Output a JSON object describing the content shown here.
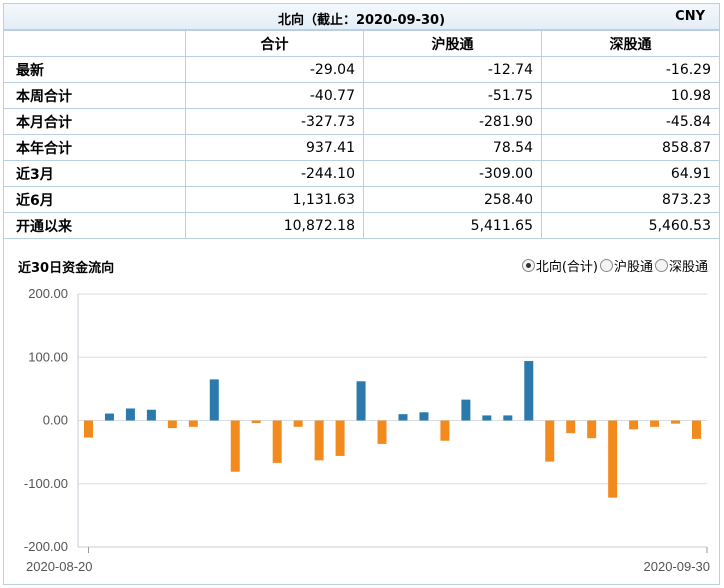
{
  "header": {
    "title": "北向（截止：2020-09-30)",
    "currency": "CNY"
  },
  "table": {
    "columns": [
      "合计",
      "沪股通",
      "深股通"
    ],
    "rows": [
      {
        "label": "最新",
        "values": [
          "-29.04",
          "-12.74",
          "-16.29"
        ]
      },
      {
        "label": "本周合计",
        "values": [
          "-40.77",
          "-51.75",
          "10.98"
        ]
      },
      {
        "label": "本月合计",
        "values": [
          "-327.73",
          "-281.90",
          "-45.84"
        ]
      },
      {
        "label": "本年合计",
        "values": [
          "937.41",
          "78.54",
          "858.87"
        ]
      },
      {
        "label": "近3月",
        "values": [
          "-244.10",
          "-309.00",
          "64.91"
        ]
      },
      {
        "label": "近6月",
        "values": [
          "1,131.63",
          "258.40",
          "873.23"
        ]
      },
      {
        "label": "开通以来",
        "values": [
          "10,872.18",
          "5,411.65",
          "5,460.53"
        ]
      }
    ]
  },
  "chart_section": {
    "title": "近30日资金流向",
    "options": [
      {
        "label": "北向(合计)",
        "selected": true
      },
      {
        "label": "沪股通",
        "selected": false
      },
      {
        "label": "深股通",
        "selected": false
      }
    ]
  },
  "chart_data": {
    "type": "bar",
    "title": "近30日资金流向",
    "ylim": [
      -200,
      200
    ],
    "yticks": [
      "200.00",
      "100.00",
      "0.00",
      "-100.00",
      "-200.00"
    ],
    "xtick_labels": [
      "2020-08-20",
      "2020-09-30"
    ],
    "grid": true,
    "positive_color": "#2a7aab",
    "negative_color": "#f28a1e",
    "values": [
      -27,
      11,
      19,
      17,
      -12,
      -10,
      65,
      -81,
      -4,
      -67,
      -10,
      -63,
      -56,
      62,
      -37,
      10,
      13,
      -32,
      33,
      8,
      8,
      94,
      -65,
      -20,
      -28,
      -122,
      -14,
      -10,
      -5,
      -29
    ]
  }
}
